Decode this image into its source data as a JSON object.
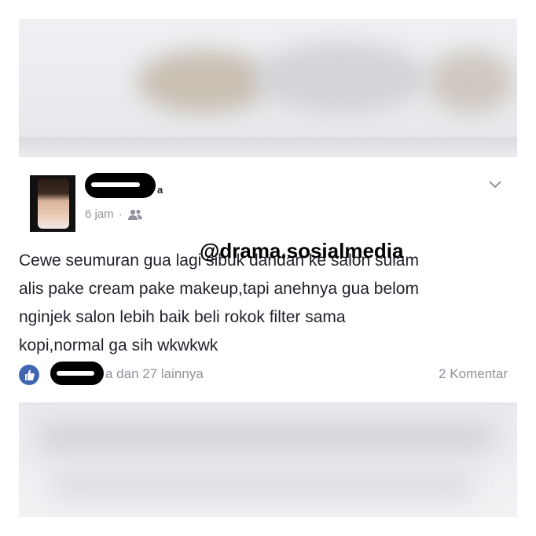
{
  "post": {
    "time": "6 jam",
    "separator": "·",
    "name_tail": "a",
    "text": "Cewe seumuran gua lagi sibuk dandan ke salon sulam\nalis pake cream pake makeup,tapi anehnya gua belom\nnginjek salon lebih baik beli rokok filter sama\nkopi,normal ga sih wkwkwk",
    "likes_text": "a dan 27 lainnya",
    "comments_text": "2 Komentar"
  },
  "watermark": "@drama.sosialmedia",
  "icons": {
    "privacy": "friends-icon",
    "menu": "chevron-down-icon",
    "reaction": "like-icon"
  },
  "colors": {
    "facebook_blue": "#4267b2",
    "meta_gray": "#90949c",
    "text": "#1d2129"
  }
}
